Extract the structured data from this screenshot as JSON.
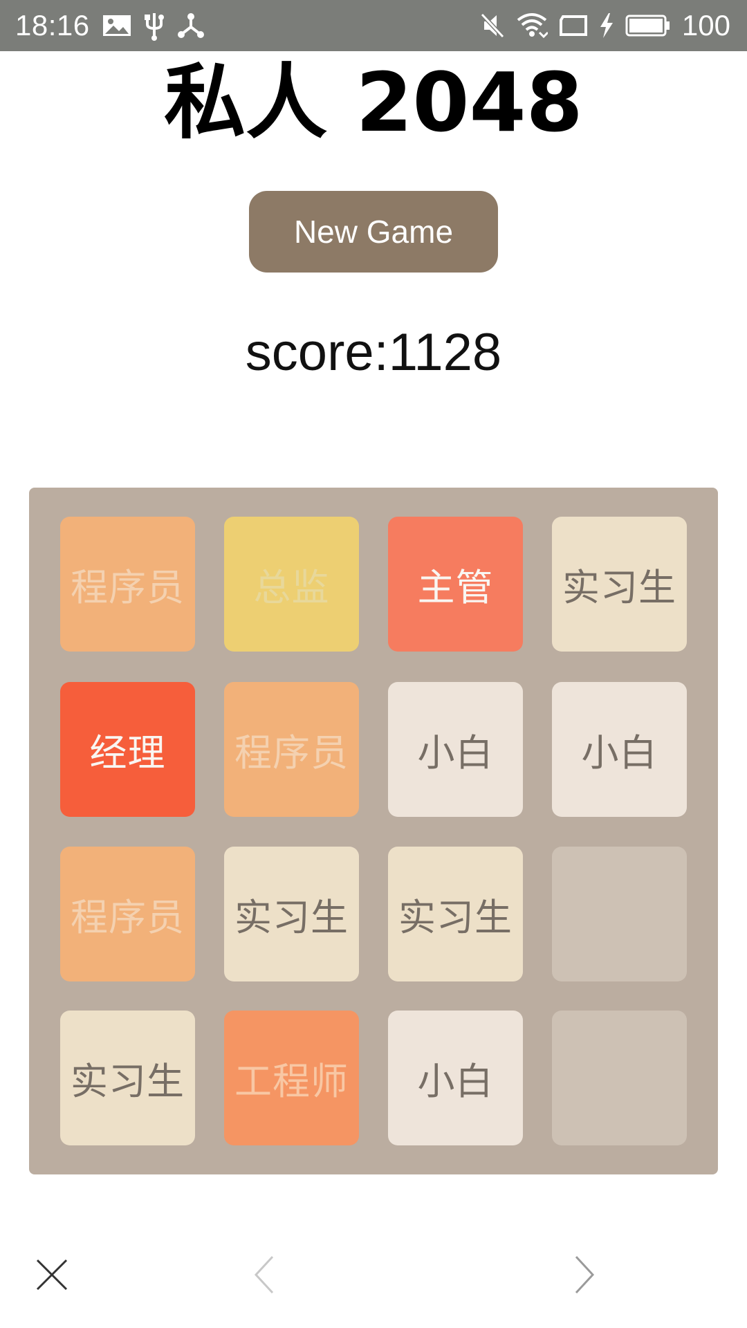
{
  "status_bar": {
    "time": "18:16",
    "left_icons": [
      "image-icon",
      "usb-icon",
      "share-node-icon"
    ],
    "right_icons": [
      "mute-icon",
      "wifi-icon",
      "screen-cast-icon",
      "charging-icon",
      "battery-icon"
    ],
    "battery_level": "100"
  },
  "app": {
    "title": "私人 2048",
    "new_game_label": "New Game",
    "score_text": "score:1128"
  },
  "board": {
    "rows": [
      [
        "程序员",
        "总监",
        "主管",
        "实习生"
      ],
      [
        "经理",
        "程序员",
        "小白",
        "小白"
      ],
      [
        "程序员",
        "实习生",
        "实习生",
        ""
      ],
      [
        "实习生",
        "工程师",
        "小白",
        ""
      ]
    ]
  },
  "bottom_nav": {
    "icons": [
      "close-icon",
      "back-icon",
      "forward-icon"
    ]
  },
  "colors": {
    "status_bar": "#7b7d79",
    "button": "#8d7a66",
    "board": "#bbada0",
    "empty_tile": "#cdc1b4",
    "xiaobai": "#eee4da",
    "shixisheng": "#ede0c8",
    "chengxuyuan": "#f2b179",
    "gongchengshi": "#f59563",
    "zhuguan": "#f67c5f",
    "jingli": "#f65e3b",
    "zongjian": "#edcf72"
  }
}
